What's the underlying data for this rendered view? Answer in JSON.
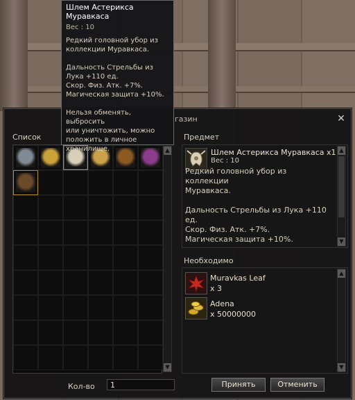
{
  "window": {
    "title_partial": "газин",
    "close_symbol": "✕"
  },
  "list_panel": {
    "header": "Список",
    "items": [
      {
        "icon": "raven-helmet-icon",
        "color": "#7f8a94"
      },
      {
        "icon": "gold-hat-icon",
        "color": "#c9a23a"
      },
      {
        "icon": "ant-helmet-icon",
        "color": "#d8cfba",
        "selected": true
      },
      {
        "icon": "horned-mask-icon",
        "color": "#caa24a"
      },
      {
        "icon": "witch-hat-icon",
        "color": "#8a5a22"
      },
      {
        "icon": "wizard-hat-icon",
        "color": "#8a3d8a"
      },
      {
        "icon": "orb-helmet-icon",
        "color": "#6b4a2a",
        "highlight": true
      }
    ]
  },
  "item_panel": {
    "header": "Предмет",
    "name": "Шлем Астерикса Муравкаса x1",
    "weight": "Вес : 10",
    "description": "Редкий головной убор из коллекции\nМуравкаса.\n\nДальность Стрельбы из Лука +110\nед.\nСкор. Физ. Атк. +7%.\nМагическая защита +10%."
  },
  "required_panel": {
    "header": "Необходимо",
    "items": [
      {
        "name": "Muravkas Leaf",
        "qty": "x 3",
        "icon": "red-leaf-icon"
      },
      {
        "name": "Adena",
        "qty": "x 50000000",
        "icon": "gold-coins-icon"
      }
    ]
  },
  "quantity": {
    "label": "Кол-во",
    "value": "1"
  },
  "buttons": {
    "accept": "Принять",
    "cancel": "Отменить"
  },
  "tooltip": {
    "title": "Шлем Астерикса Муравкаса",
    "weight": "Вес : 10",
    "text": "Редкий головной убор из\nколлекции Муравкаса.\n\nДальность Стрельбы из\nЛука +110 ед.\nСкор. Физ. Атк. +7%.\nМагическая защита +10%.\n\nНельзя обменять, выбросить\nили уничтожить, можно\nположить в личное\nхранилище."
  }
}
